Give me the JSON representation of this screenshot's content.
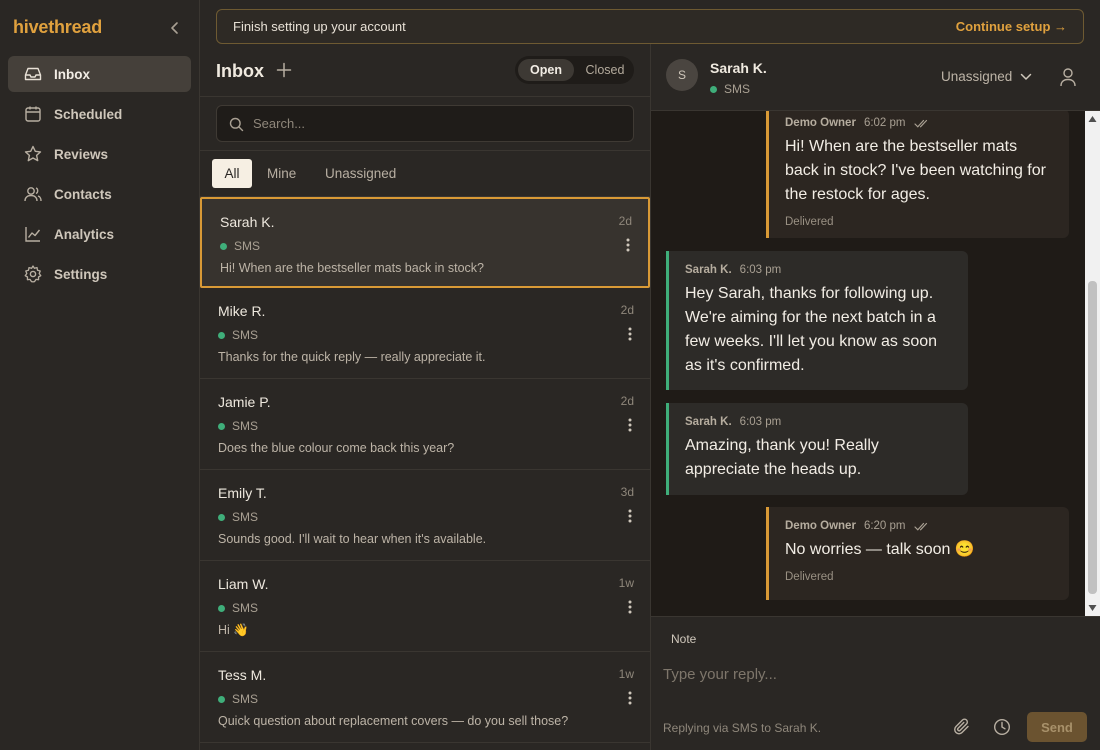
{
  "app": {
    "brand": "hivethread",
    "colors": {
      "accent": "#e0a13e",
      "sms_dot": "#3fae7a",
      "background": "#2a2724"
    }
  },
  "sidebar": {
    "collapse_icon": "chevron-left-icon",
    "items": [
      {
        "label": "Inbox",
        "icon": "inbox-icon",
        "active": true
      },
      {
        "label": "Scheduled",
        "icon": "calendar-icon",
        "active": false
      },
      {
        "label": "Reviews",
        "icon": "star-icon",
        "active": false
      },
      {
        "label": "Contacts",
        "icon": "users-icon",
        "active": false
      },
      {
        "label": "Analytics",
        "icon": "chart-line-icon",
        "active": false
      },
      {
        "label": "Settings",
        "icon": "gear-icon",
        "active": false
      }
    ]
  },
  "banner": {
    "text": "Finish setting up your account",
    "link": "Continue setup →"
  },
  "inbox": {
    "title": "Inbox",
    "toggle": {
      "open": "Open",
      "closed": "Closed",
      "selected": "Open"
    },
    "search_placeholder": "Search...",
    "filters": [
      {
        "label": "All",
        "active": true
      },
      {
        "label": "Mine",
        "active": false
      },
      {
        "label": "Unassigned",
        "active": false
      }
    ],
    "conversations": [
      {
        "name": "Sarah K.",
        "time": "2d",
        "channel": "SMS",
        "preview": "Hi! When are the bestseller mats back in stock?",
        "selected": true
      },
      {
        "name": "Mike R.",
        "time": "2d",
        "channel": "SMS",
        "preview": "Thanks for the quick reply — really appreciate it.",
        "selected": false
      },
      {
        "name": "Jamie P.",
        "time": "2d",
        "channel": "SMS",
        "preview": "Does the blue colour come back this year?",
        "selected": false
      },
      {
        "name": "Emily T.",
        "time": "3d",
        "channel": "SMS",
        "preview": "Sounds good. I'll wait to hear when it's available.",
        "selected": false
      },
      {
        "name": "Liam W.",
        "time": "1w",
        "channel": "SMS",
        "preview": "Hi 👋",
        "selected": false
      },
      {
        "name": "Tess M.",
        "time": "1w",
        "channel": "SMS",
        "preview": "Quick question about replacement covers — do you sell those?",
        "selected": false
      }
    ]
  },
  "chat": {
    "avatar_initial": "S",
    "contact_name": "Sarah K.",
    "channel": "SMS",
    "assignment": "Unassigned",
    "messages": [
      {
        "direction": "out",
        "author": "Demo Owner",
        "time": "6:02 pm",
        "text": "Hi! When are the bestseller mats back in stock? I've been watching for the restock for ages.",
        "status": "Delivered"
      },
      {
        "direction": "in",
        "author": "Sarah K.",
        "time": "6:03 pm",
        "text": "Hey Sarah, thanks for following up. We're aiming for the next batch in a few weeks. I'll let you know as soon as it's confirmed."
      },
      {
        "direction": "in",
        "author": "Sarah K.",
        "time": "6:03 pm",
        "text": "Amazing, thank you! Really appreciate the heads up."
      },
      {
        "direction": "out",
        "author": "Demo Owner",
        "time": "6:20 pm",
        "text": "No worries — talk soon 😊",
        "status": "Delivered"
      }
    ]
  },
  "composer": {
    "note_tab": "Note",
    "placeholder": "Type your reply...",
    "via": "Replying via SMS to Sarah K.",
    "send_label": "Send"
  }
}
